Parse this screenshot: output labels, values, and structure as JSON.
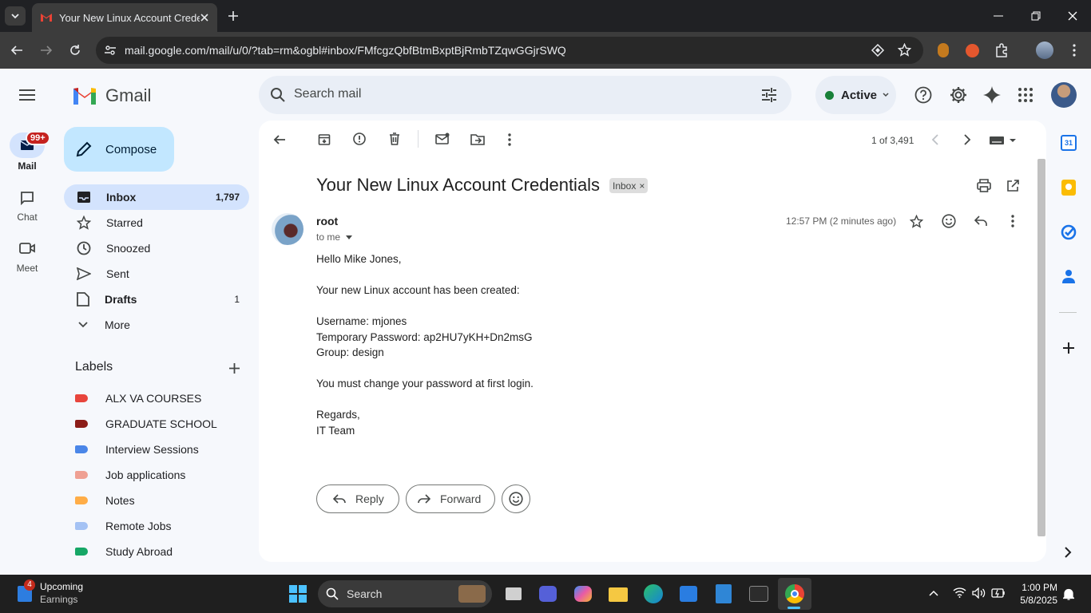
{
  "browser": {
    "tab_title": "Your New Linux Account Credentials",
    "url": "mail.google.com/mail/u/0/?tab=rm&ogbl#inbox/FMfcgzQbfBtmBxptBjRmbTZqwGGjrSWQ"
  },
  "gmail": {
    "logo_text": "Gmail",
    "search_placeholder": "Search mail",
    "status": "Active",
    "compose": "Compose",
    "rail": {
      "mail": "Mail",
      "mail_badge": "99+",
      "chat": "Chat",
      "meet": "Meet"
    },
    "nav": [
      {
        "label": "Inbox",
        "count": "1,797"
      },
      {
        "label": "Starred",
        "count": ""
      },
      {
        "label": "Snoozed",
        "count": ""
      },
      {
        "label": "Sent",
        "count": ""
      },
      {
        "label": "Drafts",
        "count": "1"
      },
      {
        "label": "More",
        "count": ""
      }
    ],
    "labels_title": "Labels",
    "labels": [
      {
        "name": "ALX VA COURSES",
        "color": "#e8453c"
      },
      {
        "name": "GRADUATE SCHOOL",
        "color": "#8c1d18"
      },
      {
        "name": "Interview Sessions",
        "color": "#4a86e8"
      },
      {
        "name": "Job applications",
        "color": "#efa093"
      },
      {
        "name": "Notes",
        "color": "#ffad47"
      },
      {
        "name": "Remote Jobs",
        "color": "#a4c2f4"
      },
      {
        "name": "Study Abroad",
        "color": "#16a766"
      }
    ]
  },
  "email": {
    "pager": "1 of 3,491",
    "subject": "Your New Linux Account Credentials",
    "tag": "Inbox",
    "sender": "root",
    "to": "to me",
    "time": "12:57 PM (2 minutes ago)",
    "body": [
      "Hello Mike Jones,",
      "Your new Linux account has been created:",
      "Username: mjones",
      "Temporary Password: ap2HU7yKH+Dn2msG",
      "Group: design",
      "You must change your password at first login.",
      "Regards,",
      "IT Team"
    ],
    "reply": "Reply",
    "forward": "Forward"
  },
  "taskbar": {
    "widget_title": "Upcoming",
    "widget_sub": "Earnings",
    "widget_badge": "4",
    "search": "Search",
    "time": "1:00 PM",
    "date": "5/8/2025"
  }
}
